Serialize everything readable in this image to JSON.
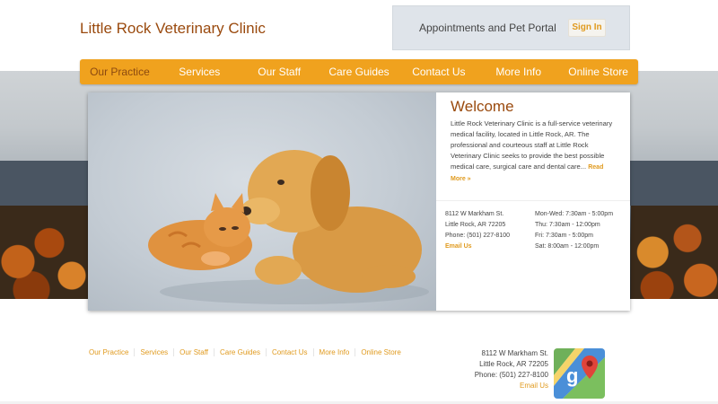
{
  "header": {
    "site_title": "Little Rock Veterinary Clinic",
    "portal_label": "Appointments and Pet Portal",
    "signin_label": "Sign In"
  },
  "nav": {
    "items": [
      {
        "label": "Our Practice",
        "active": true
      },
      {
        "label": "Services"
      },
      {
        "label": "Our Staff"
      },
      {
        "label": "Care Guides"
      },
      {
        "label": "Contact Us"
      },
      {
        "label": "More Info"
      },
      {
        "label": "Online Store"
      }
    ]
  },
  "welcome": {
    "title": "Welcome",
    "intro": "Little Rock Veterinary Clinic is a full-service veterinary medical facility, located in Little Rock, AR. The professional and courteous staff at Little Rock Veterinary Clinic seeks to provide the best possible medical care, surgical care and dental care...",
    "read_more": "Read More »"
  },
  "contact": {
    "street": "8112 W Markham St.",
    "city": "Little Rock, AR 72205",
    "phone": "Phone: (501) 227-8100",
    "email_label": "Email Us"
  },
  "hours": {
    "lines": [
      "Mon-Wed: 7:30am - 5:00pm",
      "Thu: 7:30am - 12:00pm",
      "Fri: 7:30am - 5:00pm",
      "Sat: 8:00am - 12:00pm"
    ]
  },
  "footer": {
    "links": [
      "Our Practice",
      "Services",
      "Our Staff",
      "Care Guides",
      "Contact Us",
      "More Info",
      "Online Store"
    ],
    "street": "8112 W Markham St.",
    "city": "Little Rock, AR 72205",
    "phone": "Phone: (501) 227-8100",
    "email_label": "Email Us",
    "map_icon": "google-maps-icon"
  },
  "colors": {
    "accent": "#f0a21e",
    "title": "#9a4a0e",
    "link": "#e09a1e"
  }
}
